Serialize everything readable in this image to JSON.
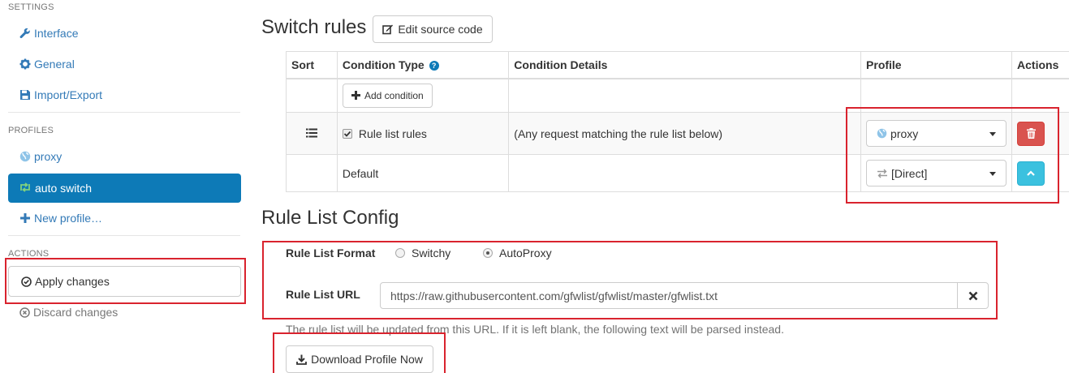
{
  "sidebar": {
    "settings_header": "SETTINGS",
    "settings_items": [
      {
        "label": "Interface",
        "icon": "wrench-icon"
      },
      {
        "label": "General",
        "icon": "gear-icon"
      },
      {
        "label": "Import/Export",
        "icon": "floppy-icon"
      }
    ],
    "profiles_header": "PROFILES",
    "profiles": [
      {
        "label": "proxy",
        "icon": "globe-icon"
      },
      {
        "label": "auto switch",
        "icon": "retweet-icon",
        "active": true
      },
      {
        "label": "New profile…",
        "icon": "plus-icon"
      }
    ],
    "actions_header": "ACTIONS",
    "apply_label": "Apply changes",
    "discard_label": "Discard changes"
  },
  "switch_rules": {
    "title": "Switch rules",
    "edit_source_label": "Edit source code",
    "columns": [
      "Sort",
      "Condition Type",
      "Condition Details",
      "Profile",
      "Actions"
    ],
    "add_condition_label": "Add condition",
    "rules": [
      {
        "condition_type": "Rule list rules",
        "checked": true,
        "details": "(Any request matching the rule list below)",
        "profile": "proxy"
      }
    ],
    "default_label": "Default",
    "default_profile": "[Direct]"
  },
  "rule_list_config": {
    "title": "Rule List Config",
    "format_label": "Rule List Format",
    "format_options": [
      "Switchy",
      "AutoProxy"
    ],
    "format_selected": "AutoProxy",
    "url_label": "Rule List URL",
    "url_value": "https://raw.githubusercontent.com/gfwlist/gfwlist/master/gfwlist.txt",
    "help_text": "The rule list will be updated from this URL. If it is left blank, the following text will be parsed instead.",
    "download_label": "Download Profile Now"
  },
  "colors": {
    "primary": "#0d7ab7",
    "link": "#337ab7",
    "danger": "#d9534f",
    "info": "#3bc1df",
    "highlight": "#d9232e"
  }
}
